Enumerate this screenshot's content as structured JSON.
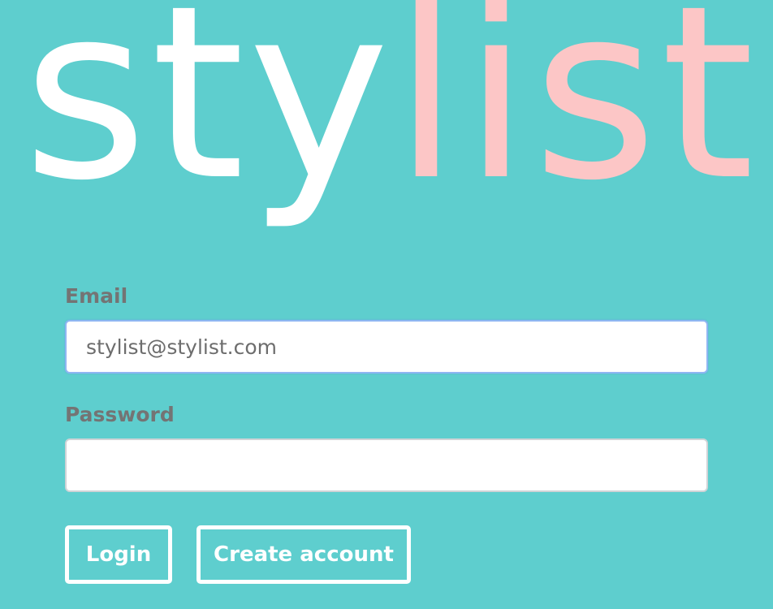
{
  "logo": {
    "part_white": "sty",
    "part_pink": "list",
    "colors": {
      "white": "#ffffff",
      "pink": "#fcc6c6"
    }
  },
  "theme": {
    "background": "#5ecece",
    "label_color": "#747474"
  },
  "form": {
    "email": {
      "label": "Email",
      "value": "stylist@stylist.com",
      "focused": true
    },
    "password": {
      "label": "Password",
      "value": ""
    },
    "buttons": {
      "login_label": "Login",
      "create_account_label": "Create account"
    }
  }
}
